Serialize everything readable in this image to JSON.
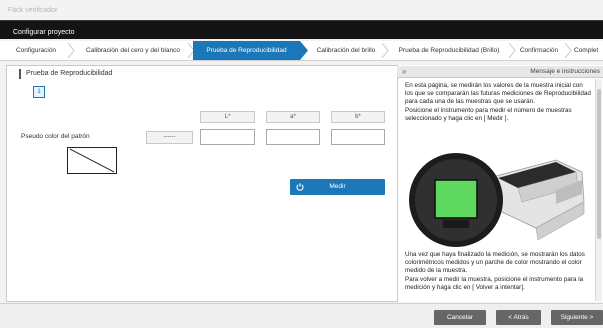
{
  "app": {
    "title": "Fäck verificador",
    "window_title": "Configurar proyecto"
  },
  "steps": [
    {
      "label": "Configuración",
      "active": false
    },
    {
      "label": "Calibración del cero y del blanco",
      "active": false
    },
    {
      "label": "Prueba de Reproducibilidad",
      "active": true
    },
    {
      "label": "Calibración del brillo",
      "active": false
    },
    {
      "label": "Prueba de Reproducibilidad (Brillo)",
      "active": false
    },
    {
      "label": "Confirmación",
      "active": false
    },
    {
      "label": "Complet",
      "active": false
    }
  ],
  "main": {
    "section_title": "Prueba de Reproducibilidad",
    "sample_number": "1",
    "headers": {
      "L": "L*",
      "a": "a*",
      "b": "b*"
    },
    "row_label": "Pseudo color del patrón",
    "dash_value": "------",
    "inputs": {
      "L": "",
      "a": "",
      "b": ""
    },
    "measure_label": "Medir"
  },
  "side": {
    "collapse_icon": "»",
    "title": "Mensaje e instrucciones",
    "top_text": [
      "En esta página, se medirán los valores de la muestra inicial con los que se compararán las futuras mediciones de Reproducibilidad para cada una de las muestras que se usarán.",
      "Posicione el instrumento para medir el número de muestras seleccionado y haga clic en [ Medir ]."
    ],
    "bottom_text": [
      "Una vez que haya finalizado la medición, se mostrarán los datos colorimétricos medidos y un parche de color mostrando el color medido de la muestra.",
      "Para volver a medir la muestra, posicione el instrumento para la medición y haga clic en [ Volver a intentar]."
    ]
  },
  "footer": {
    "cancel": "Cancelar",
    "back": "< Atrás",
    "next": "Siguiente >"
  },
  "colors": {
    "accent": "#1b77b8",
    "patch": "#5ed85e",
    "footer_button": "#666666"
  }
}
